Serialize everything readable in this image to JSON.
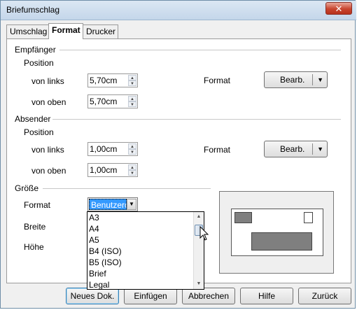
{
  "window": {
    "title": "Briefumschlag",
    "close_label": "✕"
  },
  "tabs": [
    {
      "label": "Umschlag"
    },
    {
      "label": "Format"
    },
    {
      "label": "Drucker"
    }
  ],
  "recipient": {
    "section_label": "Empfänger",
    "position_label": "Position",
    "from_left_label": "von links",
    "from_left_value": "5,70cm",
    "from_top_label": "von oben",
    "from_top_value": "5,70cm",
    "format_label": "Format",
    "edit_button": "Bearb."
  },
  "sender": {
    "section_label": "Absender",
    "position_label": "Position",
    "from_left_label": "von links",
    "from_left_value": "1,00cm",
    "from_top_label": "von oben",
    "from_top_value": "1,00cm",
    "format_label": "Format",
    "edit_button": "Bearb."
  },
  "size": {
    "section_label": "Größe",
    "format_label": "Format",
    "format_value": "Benutzerdefiniert",
    "width_label": "Breite",
    "height_label": "Höhe",
    "format_options": [
      "A3",
      "A4",
      "A5",
      "B4 (ISO)",
      "B5 (ISO)",
      "Brief",
      "Legal"
    ]
  },
  "buttons": {
    "new_doc": "Neues Dok.",
    "insert": "Einfügen",
    "cancel": "Abbrechen",
    "help": "Hilfe",
    "back": "Zurück"
  },
  "icons": {
    "dropdown": "▼",
    "spin_up": "▲",
    "spin_down": "▼"
  },
  "colors": {
    "selection": "#3399ff",
    "close_button": "#c8452f",
    "preview_box": "#7f7f7f"
  }
}
